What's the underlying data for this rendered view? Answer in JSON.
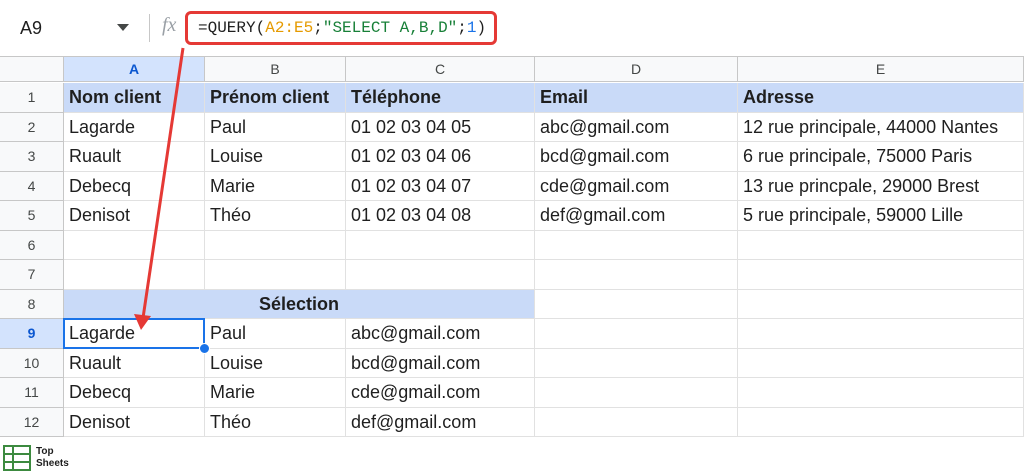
{
  "formula_bar": {
    "cell_ref": "A9",
    "fx_label": "fx",
    "formula_prefix": "=QUERY(",
    "formula_range": "A2:E5",
    "formula_sep1": ";",
    "formula_string": "\"SELECT A,B,D\"",
    "formula_sep2": ";",
    "formula_number": "1",
    "formula_suffix": ")"
  },
  "columns": [
    "A",
    "B",
    "C",
    "D",
    "E"
  ],
  "rows": [
    "1",
    "2",
    "3",
    "4",
    "5",
    "6",
    "7",
    "8",
    "9",
    "10",
    "11",
    "12"
  ],
  "table": {
    "headers": [
      "Nom client",
      "Prénom client",
      "Téléphone",
      "Email",
      "Adresse"
    ],
    "records": [
      [
        "Lagarde",
        "Paul",
        "01 02 03 04 05",
        "abc@gmail.com",
        "12 rue principale, 44000 Nantes"
      ],
      [
        "Ruault",
        "Louise",
        "01 02 03 04 06",
        "bcd@gmail.com",
        "6 rue principale, 75000 Paris"
      ],
      [
        "Debecq",
        "Marie",
        "01 02 03 04 07",
        "cde@gmail.com",
        "13 rue princpale, 29000 Brest"
      ],
      [
        "Denisot",
        "Théo",
        "01 02 03 04 08",
        "def@gmail.com",
        "5 rue principale, 59000 Lille"
      ]
    ]
  },
  "selection": {
    "title": "Sélection",
    "records": [
      [
        "Lagarde",
        "Paul",
        "abc@gmail.com"
      ],
      [
        "Ruault",
        "Louise",
        "bcd@gmail.com"
      ],
      [
        "Debecq",
        "Marie",
        "cde@gmail.com"
      ],
      [
        "Denisot",
        "Théo",
        "def@gmail.com"
      ]
    ]
  },
  "watermark": {
    "line1": "Top",
    "line2": "Sheets"
  },
  "colors": {
    "header_fill": "#c9daf8",
    "active_header": "#d3e3fd",
    "selection_border": "#1a73e8",
    "annotation_red": "#e53935"
  }
}
